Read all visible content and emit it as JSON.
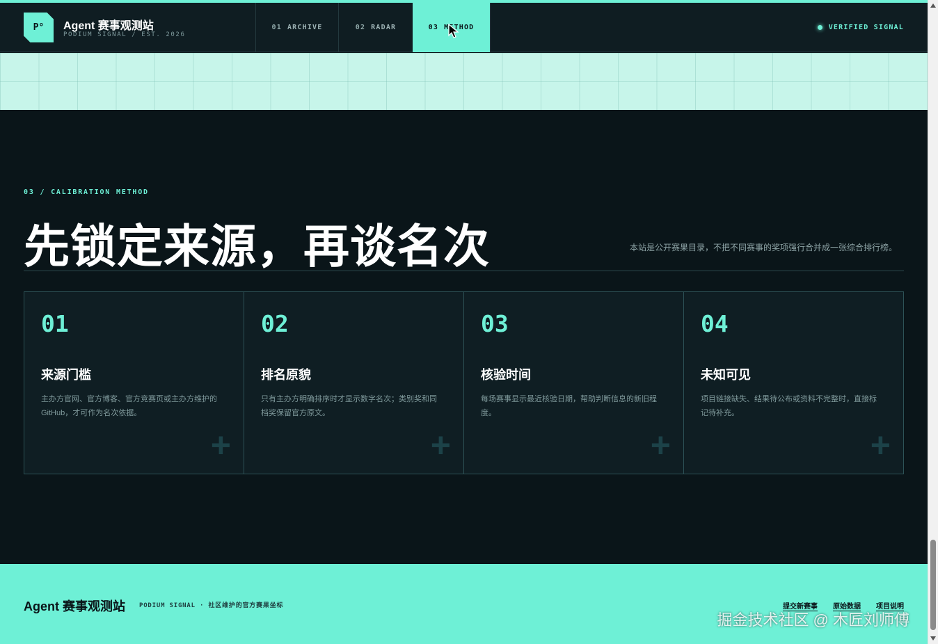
{
  "header": {
    "logo_mark": "P°",
    "brand_title": "Agent 赛事观测站",
    "brand_subtitle": "PODIUM SIGNAL / EST. 2026",
    "nav": [
      {
        "num": "01",
        "label": "ARCHIVE",
        "active": false
      },
      {
        "num": "02",
        "label": "RADAR",
        "active": false
      },
      {
        "num": "03",
        "label": "METHOD",
        "active": true
      }
    ],
    "status_label": "VERIFIED SIGNAL"
  },
  "main": {
    "eyebrow": "03 / CALIBRATION METHOD",
    "headline": "先锁定来源，再谈名次",
    "lede": "本站是公开赛果目录，不把不同赛事的奖项强行合并成一张综合排行榜。",
    "cards": [
      {
        "num": "01",
        "title": "来源门槛",
        "desc": "主办方官网、官方博客、官方竞赛页或主办方维护的 GitHub，才可作为名次依据。"
      },
      {
        "num": "02",
        "title": "排名原貌",
        "desc": "只有主办方明确排序时才显示数字名次；类别奖和同档奖保留官方原文。"
      },
      {
        "num": "03",
        "title": "核验时间",
        "desc": "每场赛事显示最近核验日期，帮助判断信息的新旧程度。"
      },
      {
        "num": "04",
        "title": "未知可见",
        "desc": "项目链接缺失、结果待公布或资料不完整时，直接标记待补充。"
      }
    ],
    "card_icon": "plus-icon"
  },
  "footer": {
    "brand": "Agent 赛事观测站",
    "tagline": "PODIUM SIGNAL · 社区维护的官方赛果坐标",
    "links": [
      "提交新赛事",
      "原始数据",
      "项目说明"
    ],
    "watermark": "掘金技术社区 @ 木匠刘师傅"
  },
  "colors": {
    "accent": "#6ef0d6",
    "background": "#0a1519",
    "card": "#0f1e23"
  }
}
